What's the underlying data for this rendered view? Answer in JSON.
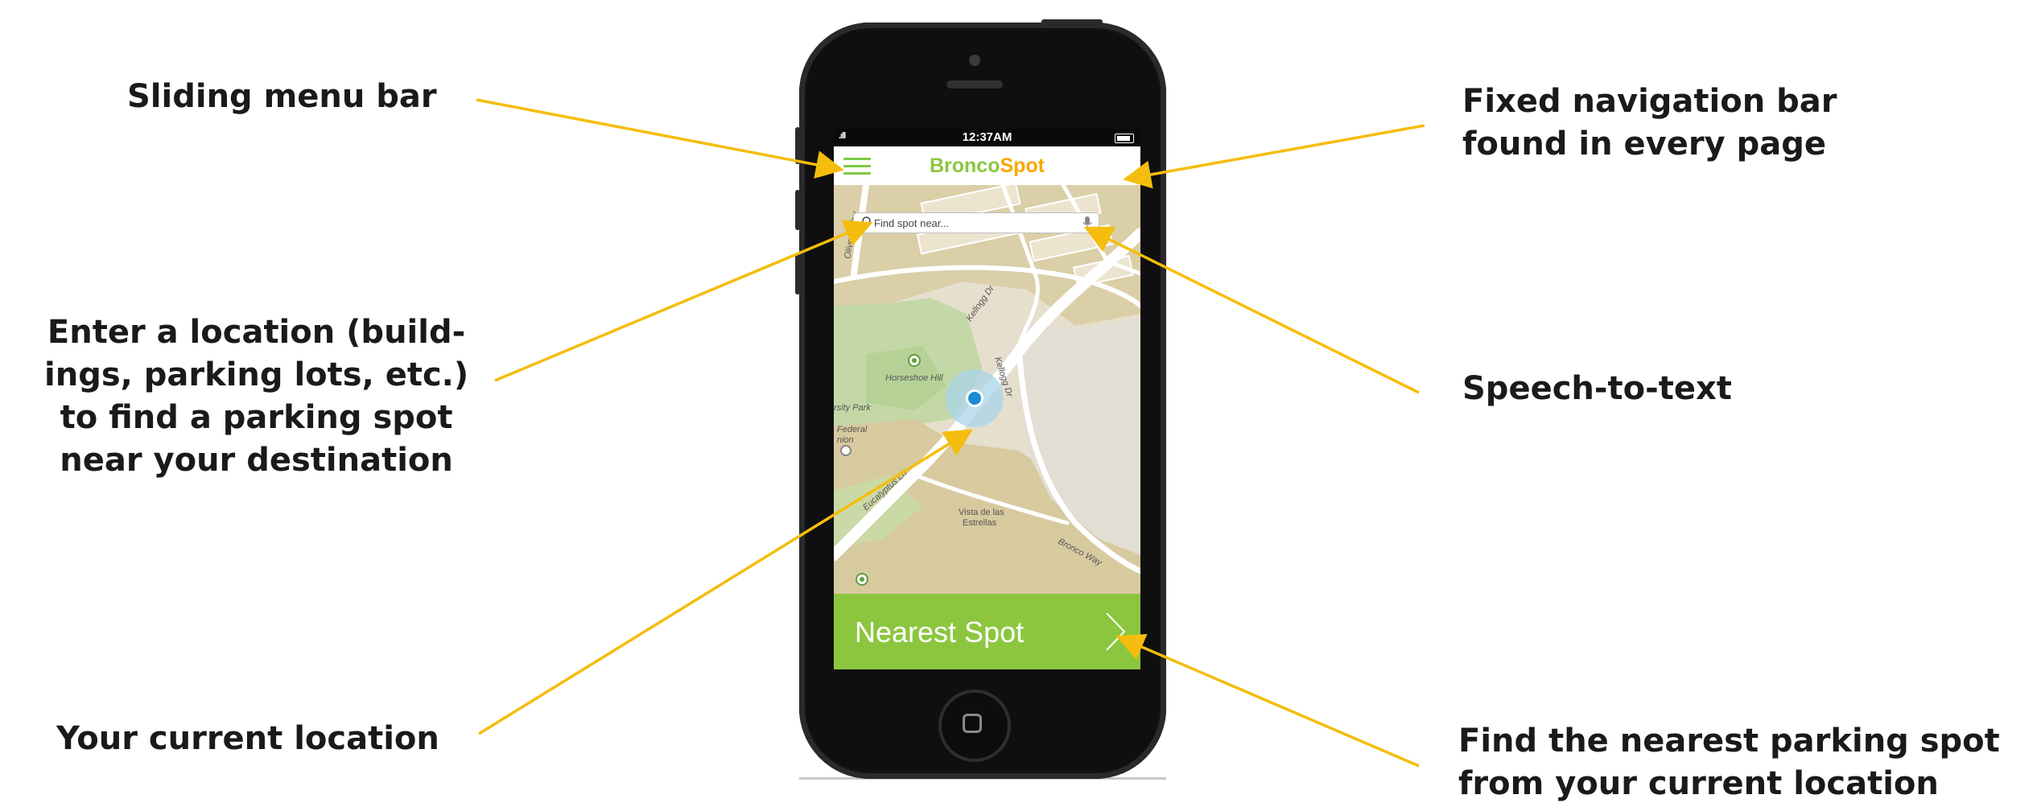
{
  "annotations": {
    "sliding_menu": "Sliding menu bar",
    "nav_bar": "Fixed navigation bar\nfound in every page",
    "enter_location": "Enter a location (build-\nings, parking lots, etc.)\nto find a parking spot\nnear your destination",
    "speech": "Speech-to-text",
    "current_location": "Your current location",
    "nearest_spot": "Find the nearest parking spot\nfrom your current location"
  },
  "phone": {
    "status_time": "12:37AM",
    "signal": ".ıll"
  },
  "app": {
    "logo_first": "Bronco",
    "logo_second": "Spot",
    "search_placeholder": "Find spot near...",
    "nearest_button": "Nearest Spot"
  },
  "map": {
    "labels": {
      "olive": "Olive L Way",
      "kellogg1": "Kellogg Dr",
      "kellogg2": "Kellogg Dr",
      "horseshoe": "Horseshoe Hill",
      "university_park": "rsity Park",
      "federal": "Federal",
      "union": "nion",
      "eucalyptus": "Eucalyptus Ln",
      "vista1": "Vista de las",
      "vista2": "Estrellas",
      "bronco_way": "Bronco Way"
    }
  },
  "colors": {
    "accent_green": "#8cc63f",
    "logo_orange": "#f7a800",
    "arrow_yellow": "#f5bd0d",
    "location_blue": "#1a8ad4"
  }
}
